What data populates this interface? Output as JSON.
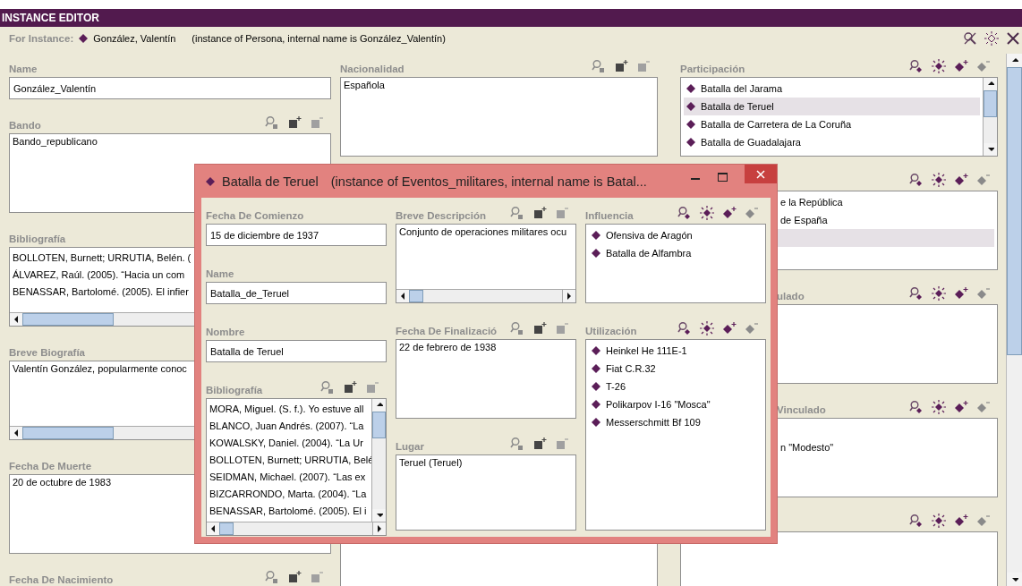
{
  "editor": {
    "title": "INSTANCE EDITOR",
    "for_label": "For Instance:",
    "instance_name": "González, Valentín",
    "instance_info": "(instance of Persona, internal name is González_Valentín)"
  },
  "columns": [
    {
      "fields": [
        {
          "label": "Name",
          "kind": "text",
          "value": "González_Valentín"
        },
        {
          "label": "Bando",
          "kind": "area",
          "value_tools": true,
          "value": "Bando_republicano"
        },
        {
          "label": "Bibliografía",
          "kind": "lines",
          "hscroll": true,
          "lines": [
            "BOLLOTEN, Burnett; URRUTIA, Belén. (",
            "ÁLVAREZ, Raúl. (2005). “Hacia un com",
            "BENASSAR, Bartolomé. (2005). El infier"
          ]
        },
        {
          "label": "Breve Biografía",
          "kind": "area",
          "hscroll": true,
          "value": "Valentín González, popularmente conoc"
        },
        {
          "label": "Fecha De Muerte",
          "kind": "area",
          "value": "20 de octubre de 1983"
        },
        {
          "label": "Fecha De Nacimiento",
          "kind": "area",
          "value_tools": true
        }
      ]
    },
    {
      "fields": [
        {
          "label": "Nacionalidad",
          "kind": "area",
          "value_tools": true,
          "value": "Española"
        },
        {
          "kind": "area"
        }
      ]
    },
    {
      "fields": [
        {
          "label": "Participación",
          "kind": "list",
          "instance_tools": true,
          "vscroll": true,
          "items": [
            {
              "text": "Batalla del Jarama",
              "selected": false
            },
            {
              "text": "Batalla de Teruel",
              "selected": true
            },
            {
              "text": "Batalla de Carretera de La Coruña",
              "selected": false
            },
            {
              "text": "Batalla de Guadalajara",
              "selected": false
            }
          ]
        },
        {
          "kind": "list",
          "instance_tools": true,
          "occluded": true,
          "items": [
            {
              "text": "e la República",
              "selected": false
            },
            {
              "text": "de España",
              "selected": false
            },
            {
              "selected": true
            }
          ]
        },
        {
          "label": "ulado",
          "kind": "list",
          "instance_tools": true,
          "occluded": true
        },
        {
          "label": "Vinculado",
          "kind": "list",
          "instance_tools": true,
          "occluded": true,
          "items": [
            {
              "selected": false
            },
            {
              "text": "n \"Modesto\"",
              "selected": false
            }
          ]
        },
        {
          "kind": "list",
          "instance_tools": true
        }
      ]
    }
  ],
  "dialog": {
    "title": "Batalla de Teruel",
    "subtitle": "(instance of Eventos_militares, internal name is Batal...",
    "columns": [
      {
        "fields": [
          {
            "label": "Fecha De Comienzo",
            "kind": "text",
            "value": "15 de diciembre de 1937"
          },
          {
            "label": "Name",
            "kind": "text",
            "value": "Batalla_de_Teruel"
          },
          {
            "label": "Nombre",
            "kind": "text",
            "value": "Batalla de Teruel"
          },
          {
            "label": "Bibliografía",
            "kind": "lines",
            "value_tools": true,
            "vscroll": true,
            "hscroll": true,
            "lines": [
              "MORA, Miguel. (S. f.). Yo estuve all",
              "BLANCO, Juan Andrés. (2007). “La",
              "KOWALSKY, Daniel. (2004). “La Ur",
              "BOLLOTEN, Burnett; URRUTIA, Belé",
              "SEIDMAN, Michael. (2007). “Las ex",
              "BIZCARRONDO, Marta. (2004). “La",
              "BENASSAR, Bartolomé. (2005). El i"
            ]
          }
        ]
      },
      {
        "fields": [
          {
            "label": "Breve Descripción",
            "kind": "area",
            "value_tools": true,
            "hscroll": true,
            "value": "Conjunto de operaciones militares ocu"
          },
          {
            "label": "Fecha De Finalizació",
            "kind": "area",
            "value_tools": true,
            "value": "22 de febrero de 1938"
          },
          {
            "label": "Lugar",
            "kind": "area",
            "value_tools": true,
            "value": "Teruel (Teruel)"
          }
        ]
      },
      {
        "fields": [
          {
            "label": "Influencia",
            "kind": "list",
            "instance_tools": true,
            "items": [
              {
                "text": "Ofensiva de Aragón",
                "selected": false
              },
              {
                "text": "Batalla de Alfambra",
                "selected": false
              }
            ]
          },
          {
            "label": "Utilización",
            "kind": "list",
            "instance_tools": true,
            "items": [
              {
                "text": "Heinkel He 111E-1",
                "selected": false
              },
              {
                "text": "Fiat C.R.32",
                "selected": false
              },
              {
                "text": "T-26",
                "selected": false
              },
              {
                "text": "Polikarpov I-16 \"Mosca\"",
                "selected": false
              },
              {
                "text": "Messerschmitt Bf 109",
                "selected": false
              }
            ]
          }
        ]
      }
    ]
  }
}
